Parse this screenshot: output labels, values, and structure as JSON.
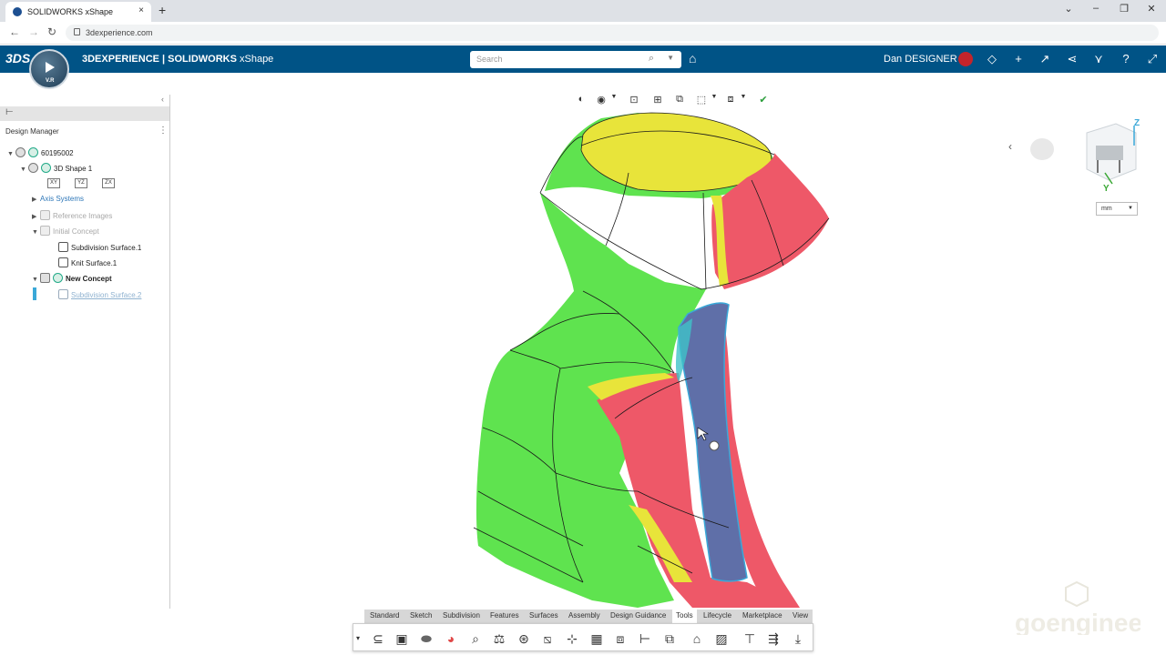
{
  "browser": {
    "tab_title": "SOLIDWORKS xShape",
    "url": "3dexperience.com",
    "new_tab": "+",
    "close_tab": "×"
  },
  "header": {
    "app_title_bold": "3DEXPERIENCE | SOLIDWORKS",
    "app_title_rest": " xShape",
    "compass_label": "V.R",
    "search_placeholder": "Search",
    "username": "Dan DESIGNER",
    "icons": [
      "share-icon",
      "plus-icon",
      "forward-icon",
      "collaborate-icon",
      "apps-icon",
      "help-icon",
      "fullscreen-icon"
    ]
  },
  "design_manager": {
    "title": "Design Manager",
    "tree": [
      {
        "label": "60195002",
        "level": 0,
        "expanded": true,
        "style": "bold"
      },
      {
        "label": "3D Shape 1",
        "level": 1,
        "expanded": true,
        "style": "normal"
      },
      {
        "label": "Axis Systems",
        "level": 2,
        "expanded": false,
        "style": "link"
      },
      {
        "label": "Reference Images",
        "level": 2,
        "expanded": false,
        "style": "dim"
      },
      {
        "label": "Initial Concept",
        "level": 2,
        "expanded": true,
        "style": "dim"
      },
      {
        "label": "Subdivision Surface.1",
        "level": 3,
        "style": "normal"
      },
      {
        "label": "Knit Surface.1",
        "level": 3,
        "style": "normal"
      },
      {
        "label": "New Concept",
        "level": 2,
        "expanded": true,
        "style": "bold"
      },
      {
        "label": "Subdivision Surface.2",
        "level": 3,
        "style": "link-underline"
      }
    ],
    "planes": [
      "XY",
      "YZ",
      "ZX"
    ]
  },
  "viewport": {
    "unit": "mm",
    "axis_z": "Z",
    "axis_y": "Y"
  },
  "command_tabs": [
    "Standard",
    "Sketch",
    "Subdivision",
    "Features",
    "Surfaces",
    "Assembly",
    "Design Guidance",
    "Tools",
    "Lifecycle",
    "Marketplace",
    "View"
  ],
  "active_tab": "Tools",
  "watermark": "goengineer",
  "colors": {
    "header_bg": "#005386",
    "accent_blue": "#2e77b8",
    "surface_green": "#5fe34f",
    "surface_red": "#ee5868",
    "surface_yellow": "#e8e43a",
    "selection_blue": "#3aa8d8"
  }
}
